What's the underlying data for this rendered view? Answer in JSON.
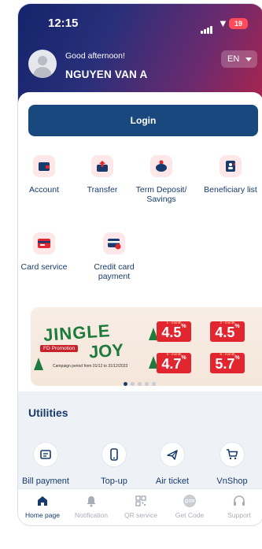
{
  "status_bar": {
    "time": "12:15",
    "battery": "19",
    "icons": [
      "signal-icon",
      "wifi-icon",
      "battery-icon"
    ]
  },
  "header": {
    "greeting": "Good afternoon!",
    "username": "NGUYEN VAN A",
    "language": "EN"
  },
  "login": {
    "label": "Login"
  },
  "services": [
    {
      "label": "Account",
      "icon": "wallet-icon"
    },
    {
      "label": "Transfer",
      "icon": "transfer-icon"
    },
    {
      "label": "Term Deposit/ Savings",
      "icon": "piggy-bank-icon"
    },
    {
      "label": "Beneficiary list",
      "icon": "contact-book-icon"
    },
    {
      "label": "Card service",
      "icon": "card-icon"
    },
    {
      "label": "Credit card payment",
      "icon": "credit-card-payment-icon"
    }
  ],
  "banner": {
    "title_line1": "JINGLE",
    "title_line2": "JOY",
    "tag": "FD Promotion",
    "campaign": "Campaign period from 01/12 to 31/12/2023",
    "rates": [
      {
        "term": "1 - month",
        "value": "4.5"
      },
      {
        "term": "2 - month",
        "value": "4.5"
      },
      {
        "term": "3 - month",
        "value": "4.7"
      },
      {
        "term": "6 - month",
        "value": "5.7"
      }
    ],
    "percent_sign": "%",
    "page_count": 5,
    "active_page": 0
  },
  "utilities": {
    "title": "Utilities",
    "items": [
      {
        "label": "Bill payment",
        "icon": "bill-icon"
      },
      {
        "label": "Top-up",
        "icon": "phone-icon"
      },
      {
        "label": "Air ticket",
        "icon": "airplane-icon"
      },
      {
        "label": "VnShop",
        "icon": "cart-icon"
      }
    ]
  },
  "bottom_nav": [
    {
      "label": "Home page",
      "icon": "home-icon",
      "active": true
    },
    {
      "label": "Notification",
      "icon": "bell-icon",
      "active": false
    },
    {
      "label": "QR service",
      "icon": "qr-icon",
      "active": false
    },
    {
      "label": "Get Code",
      "icon": "otp-icon",
      "active": false
    },
    {
      "label": "Support",
      "icon": "headset-icon",
      "active": false
    }
  ],
  "colors": {
    "primary": "#19487e",
    "text_primary": "#163b6c",
    "accent_red": "#e22630",
    "icon_tile": "#fde7e8",
    "inactive": "#a8adb8"
  }
}
